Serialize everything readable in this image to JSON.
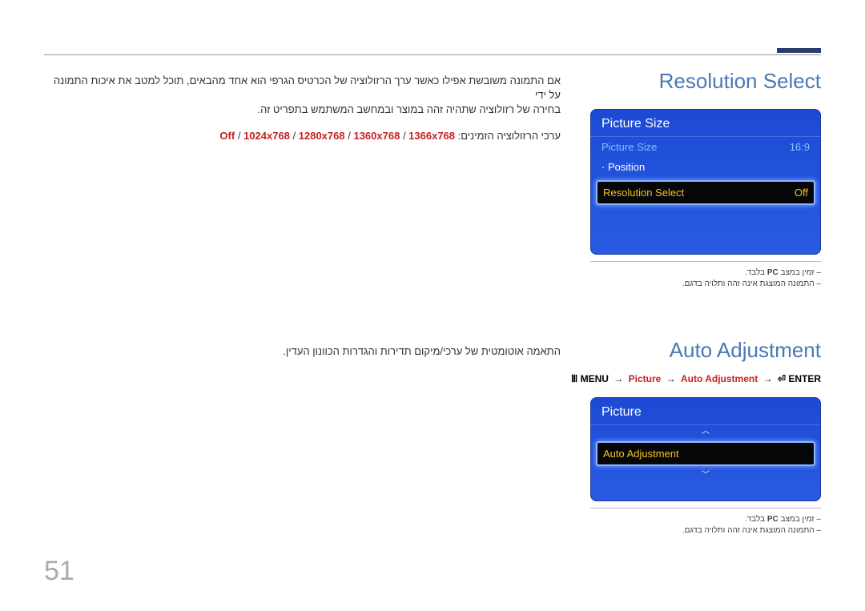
{
  "page_number": "51",
  "section1": {
    "heading": "Resolution Select",
    "osd": {
      "title": "Picture Size",
      "row1_label": "Picture Size",
      "row1_value": "16:9",
      "row2_label": "Position",
      "row3_label": "Resolution Select",
      "row3_value": "Off"
    },
    "footnote_a_pre": "זמין במצב ",
    "footnote_a_bold": "PC",
    "footnote_a_post": " בלבד.",
    "footnote_b": "התמונה המוצגת אינה זהה ותלויה בדגם.",
    "body_line_a": "אם התמונה משובשת אפילו כאשר ערך הרזולוציה של הכרטיס הגרפי הוא אחד מהבאים, תוכל למטב את איכות התמונה על ידי",
    "body_line_b": "בחירה של רזולוציה שתהיה זהה במוצר ובמחשב המשתמש בתפריט זה.",
    "avail_prefix": "ערכי הרזולוציה הזמינים: ",
    "avail_off": "Off",
    "avail_r1": "1024x768",
    "avail_r2": "1280x768",
    "avail_r3": "1360x768",
    "avail_r4": "1366x768"
  },
  "section2": {
    "heading": "Auto Adjustment",
    "nav": {
      "menu": "MENU",
      "picture": "Picture",
      "auto_adj": "Auto Adjustment",
      "enter": "ENTER"
    },
    "osd": {
      "title": "Picture",
      "row_label": "Auto Adjustment"
    },
    "footnote_a_pre": "זמין במצב ",
    "footnote_a_bold": "PC",
    "footnote_a_post": " בלבד.",
    "footnote_b": "התמונה המוצגת אינה זהה ותלויה בדגם.",
    "body": "התאמה אוטומטית של ערכי/מיקום תדירות והגדרות הכוונון העדין."
  }
}
